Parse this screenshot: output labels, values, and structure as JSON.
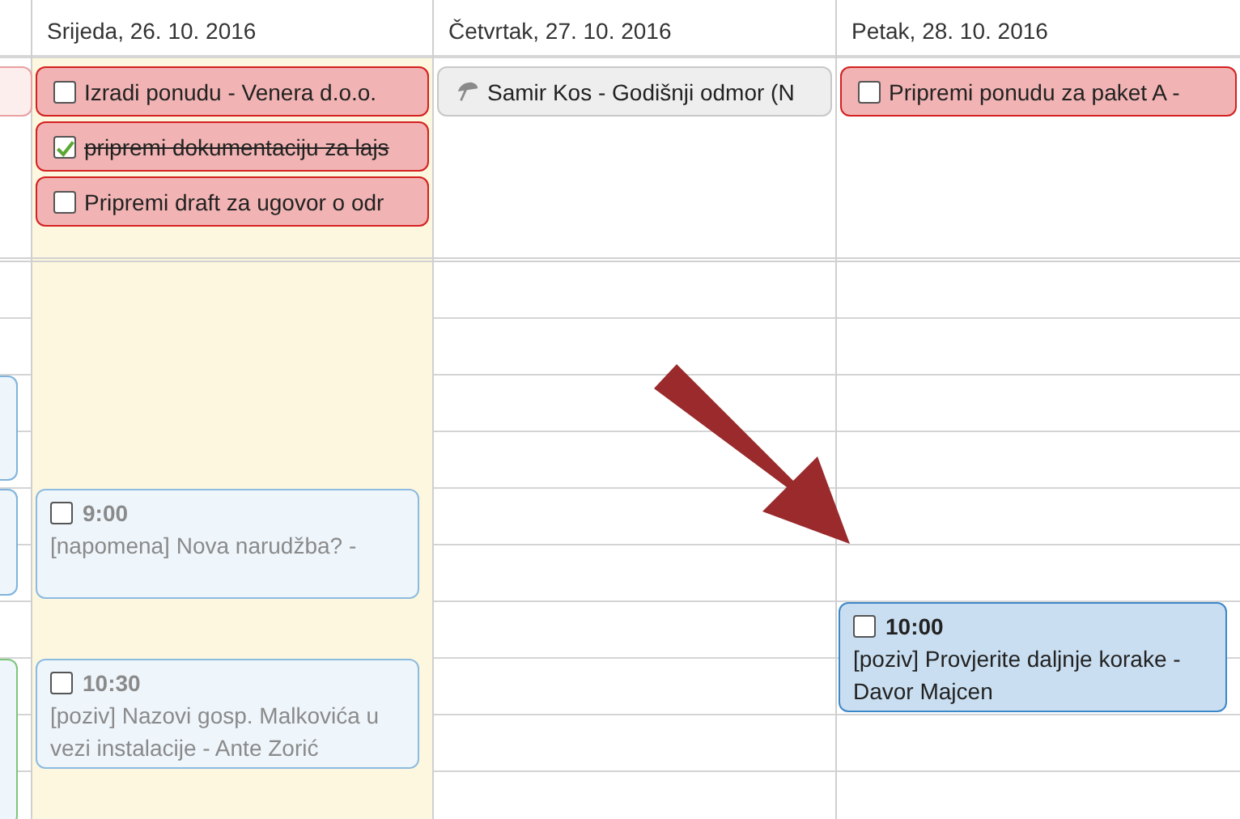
{
  "partial_column": {
    "all_day": [
      {
        "kind": "task"
      }
    ],
    "events": [
      {
        "color": "#7fb3dc"
      },
      {
        "color": "#7fb3dc"
      },
      {
        "color": "#7cc67c"
      }
    ]
  },
  "days": [
    {
      "label": "Srijeda, 26. 10. 2016",
      "today": true,
      "all_day": [
        {
          "kind": "task",
          "checked": false,
          "text": "Izradi ponudu - Venera d.o.o."
        },
        {
          "kind": "task",
          "checked": true,
          "text": "pripremi dokumentaciju za lajs"
        },
        {
          "kind": "task",
          "checked": false,
          "text": "Pripremi draft za ugovor o odr"
        }
      ],
      "events": [
        {
          "time": "9:00",
          "text": "[napomena] Nova narudžba? -",
          "checked": false,
          "selected": false
        },
        {
          "time": "10:30",
          "text": "[poziv] Nazovi gosp. Malkovića u vezi instalacije - Ante Zorić",
          "checked": false,
          "selected": false
        }
      ]
    },
    {
      "label": "Četvrtak, 27. 10. 2016",
      "today": false,
      "all_day": [
        {
          "kind": "absence",
          "text": "Samir Kos - Godišnji odmor (N"
        }
      ]
    },
    {
      "label": "Petak, 28. 10. 2016",
      "today": false,
      "all_day": [
        {
          "kind": "task",
          "checked": false,
          "text": "Pripremi ponudu za paket A -"
        }
      ],
      "events": [
        {
          "time": "10:00",
          "text": "[poziv] Provjerite daljnje korake - Davor Majcen",
          "checked": false,
          "selected": true
        }
      ]
    }
  ]
}
